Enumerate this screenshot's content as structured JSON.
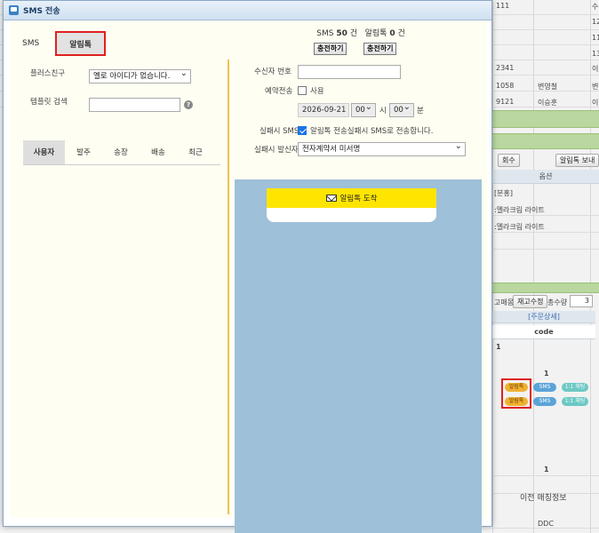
{
  "dialog": {
    "title": "SMS 전송",
    "tabs": [
      "SMS",
      "알림톡"
    ],
    "active_tab": "알림톡",
    "credits": {
      "sms_label": "SMS",
      "sms_count": "50",
      "sms_unit": "건",
      "alim_label": "알림톡",
      "alim_count": "0",
      "alim_unit": "건",
      "charge_label": "충전하기"
    },
    "left": {
      "plusfriend_label": "플러스친구",
      "plusfriend_value": "옐로 아이디가 없습니다.",
      "template_label": "템플릿 검색",
      "template_value": "",
      "help_icon": "?",
      "subtabs": [
        "사용자",
        "발주",
        "송장",
        "배송",
        "최근"
      ]
    },
    "right": {
      "recipient_label": "수신자 번호",
      "recipient_value": "",
      "reserve_label": "예약전송",
      "reserve_use_label": "사용",
      "reserve_date": "2026-09-21",
      "reserve_hour": "00",
      "hour_unit": "시",
      "reserve_min": "00",
      "min_unit": "분",
      "fail_sms_label": "실패시 SMS",
      "fail_sms_text": "알림톡 전송실패시 SMS로 전송합니다.",
      "fail_sender_label": "실패시 발신자",
      "fail_sender_value": "전자계약서 미서명",
      "preview_header": "알림톡 도착"
    }
  },
  "background": {
    "top_cells": [
      "111",
      "수",
      "12",
      "11",
      "13"
    ],
    "rows": [
      {
        "code": "2341",
        "name": "",
        "extra": "이"
      },
      {
        "code": "1058",
        "name": "변영철",
        "extra": "변"
      },
      {
        "code": "9121",
        "name": "이승훈",
        "extra": "이"
      }
    ],
    "buttons": [
      "회수",
      "알림톡 보내"
    ],
    "option_header": "옵션",
    "option_rows": [
      "[분홍]",
      ":멜라크림 라이트",
      ":멜라크림 라이트"
    ],
    "stock_button": "재고수정",
    "stock_prefix": "고매몽",
    "total_label": "총수량",
    "total_value": "3",
    "detail_header": "[주문상세]",
    "code_header": "code",
    "code_values": [
      "1",
      "1"
    ],
    "pills": {
      "alim": "알림톡",
      "sms": "SMS",
      "chat": "1:1 채팅"
    },
    "footer_value": "1",
    "footer_label": "이전 매칭정보",
    "footer_code": "DDC"
  }
}
